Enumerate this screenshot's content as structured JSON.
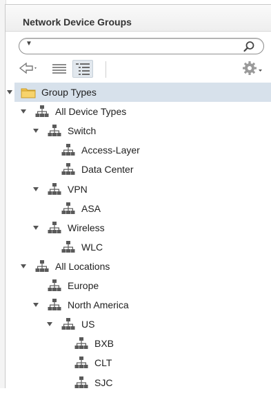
{
  "panel": {
    "title": "Network Device Groups"
  },
  "search": {
    "placeholder": ""
  },
  "toolbar": {
    "back_icon": "back-arrow-icon",
    "list_icon": "list-view-icon",
    "tree_icon": "tree-view-icon",
    "settings_icon": "gear-icon"
  },
  "tree": [
    {
      "label": "Group Types",
      "icon": "folder-icon",
      "expanded": true,
      "selected": true,
      "depth": 0
    },
    {
      "label": "All Device Types",
      "icon": "network-group-icon",
      "expanded": true,
      "depth": 1
    },
    {
      "label": "Switch",
      "icon": "network-group-icon",
      "expanded": true,
      "depth": 2
    },
    {
      "label": "Access-Layer",
      "icon": "network-group-icon",
      "depth": 3
    },
    {
      "label": "Data Center",
      "icon": "network-group-icon",
      "depth": 3
    },
    {
      "label": "VPN",
      "icon": "network-group-icon",
      "expanded": true,
      "depth": 2
    },
    {
      "label": "ASA",
      "icon": "network-group-icon",
      "depth": 3
    },
    {
      "label": "Wireless",
      "icon": "network-group-icon",
      "expanded": true,
      "depth": 2
    },
    {
      "label": "WLC",
      "icon": "network-group-icon",
      "depth": 3
    },
    {
      "label": "All Locations",
      "icon": "network-group-icon",
      "expanded": true,
      "depth": 1
    },
    {
      "label": "Europe",
      "icon": "network-group-icon",
      "depth": 2
    },
    {
      "label": "North America",
      "icon": "network-group-icon",
      "expanded": true,
      "depth": 2
    },
    {
      "label": "US",
      "icon": "network-group-icon",
      "expanded": true,
      "depth": 3
    },
    {
      "label": "BXB",
      "icon": "network-group-icon",
      "depth": 4
    },
    {
      "label": "CLT",
      "icon": "network-group-icon",
      "depth": 4
    },
    {
      "label": "SJC",
      "icon": "network-group-icon",
      "depth": 4
    }
  ],
  "colors": {
    "selected_row": "#d7e1eb",
    "folder": "#f2c44e",
    "network_icon": "#5a5a5a"
  }
}
